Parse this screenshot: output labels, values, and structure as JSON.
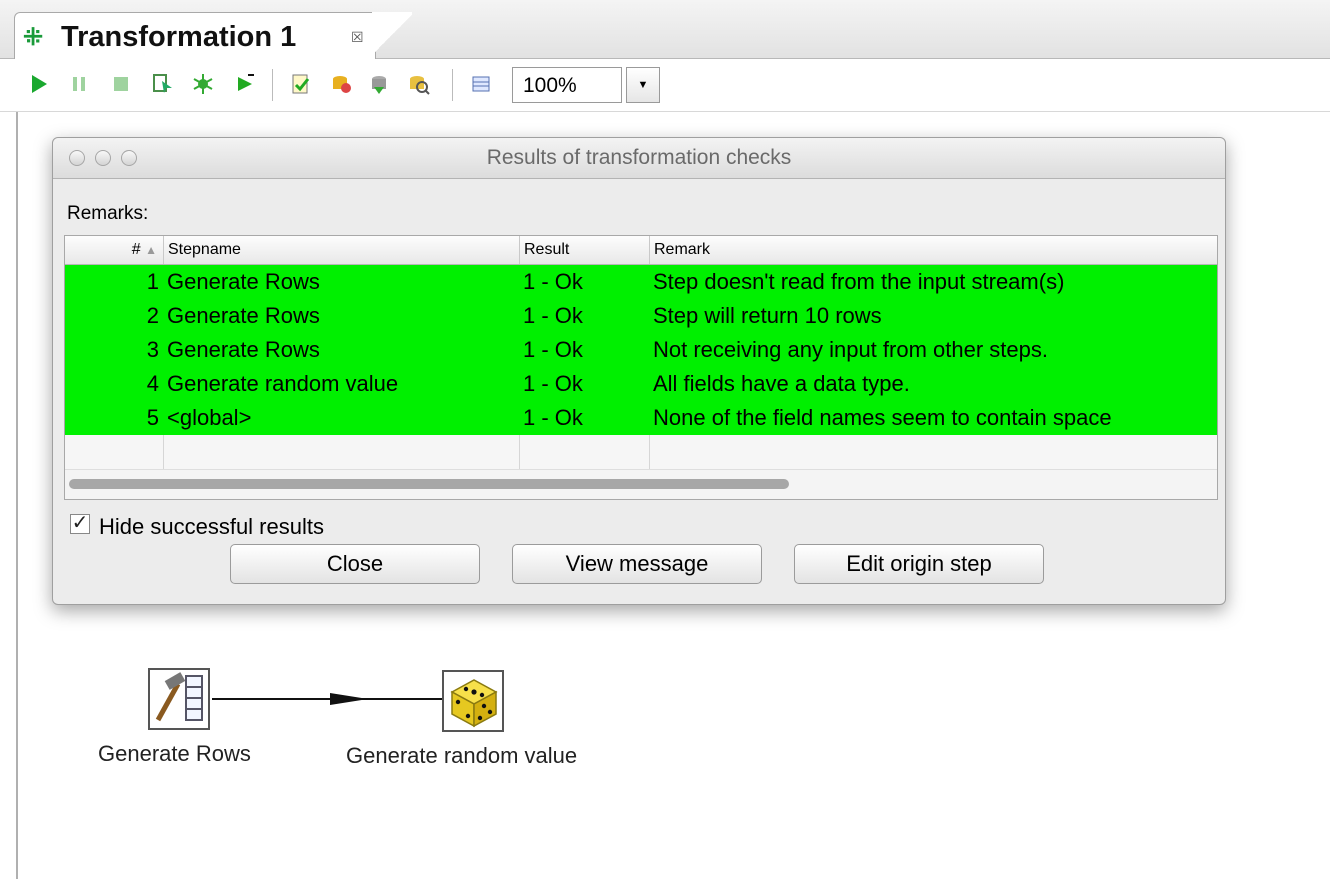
{
  "tab": {
    "title": "Transformation 1",
    "close_glyph": "☒"
  },
  "toolbar": {
    "zoom_value": "100%",
    "icons": [
      "run-icon",
      "pause-icon",
      "stop-icon",
      "preview-icon",
      "debug-icon",
      "replay-icon",
      "verify-icon",
      "impact-icon",
      "sql-icon",
      "explore-db-icon",
      "show-results-icon"
    ]
  },
  "dialog": {
    "title": "Results of transformation checks",
    "remarks_label": "Remarks:",
    "columns": {
      "num": "#",
      "sort_indicator": "▲",
      "stepname": "Stepname",
      "result": "Result",
      "remark": "Remark"
    },
    "rows": [
      {
        "num": "1",
        "stepname": "Generate Rows",
        "result": "1 - Ok",
        "remark": "Step doesn't read from the input stream(s)"
      },
      {
        "num": "2",
        "stepname": "Generate Rows",
        "result": "1 - Ok",
        "remark": "Step will return 10 rows"
      },
      {
        "num": "3",
        "stepname": "Generate Rows",
        "result": "1 - Ok",
        "remark": "Not receiving any input from other steps."
      },
      {
        "num": "4",
        "stepname": "Generate random value",
        "result": "1 - Ok",
        "remark": "All fields have a data type."
      },
      {
        "num": "5",
        "stepname": "<global>",
        "result": "1 - Ok",
        "remark": "None of the field names seem to contain space"
      }
    ],
    "row_ok_color": "#00f000",
    "hide_successful_label": "Hide successful results",
    "hide_successful_checked": true,
    "buttons": {
      "close": "Close",
      "view_message": "View message",
      "edit_origin": "Edit origin step"
    }
  },
  "canvas": {
    "steps": [
      {
        "label": "Generate Rows",
        "icon": "generate-rows-icon"
      },
      {
        "label": "Generate random value",
        "icon": "dice-icon"
      }
    ]
  }
}
